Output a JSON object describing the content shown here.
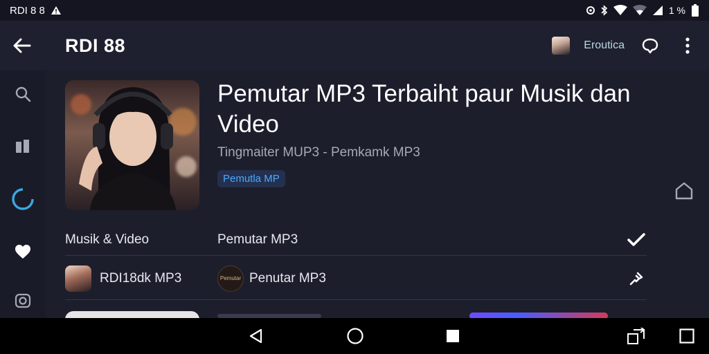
{
  "status_bar": {
    "left_text": "RDI 8 8",
    "battery_text": "1 %"
  },
  "app_bar": {
    "title": "RDI 88",
    "brand_link": "Eroutica"
  },
  "hero": {
    "title": "Pemutar MP3 Terbaiht paur Musik dan Video",
    "subtitle": "Tingmaiter MUP3 - Pemkamk MP3",
    "chip": "Pemutla MP"
  },
  "rows": [
    {
      "left": "Musik & Video",
      "right": "Pemutar MP3"
    },
    {
      "left": "RDI18dk MP3",
      "right": "Penutar MP3",
      "logo_text": "Pemutar"
    }
  ],
  "icons": {
    "back": "arrow-left-icon",
    "search": "search-icon",
    "library": "library-icon",
    "loading": "loading-ring-icon",
    "favorite": "heart-icon",
    "camera": "camera-icon",
    "chat": "chat-icon",
    "more": "more-vertical-icon",
    "home": "home-icon",
    "check": "check-icon",
    "pin": "pin-icon"
  },
  "colors": {
    "accent": "#3aa8e0",
    "chip_text": "#4fa8ff",
    "background": "#1d1e2c"
  }
}
